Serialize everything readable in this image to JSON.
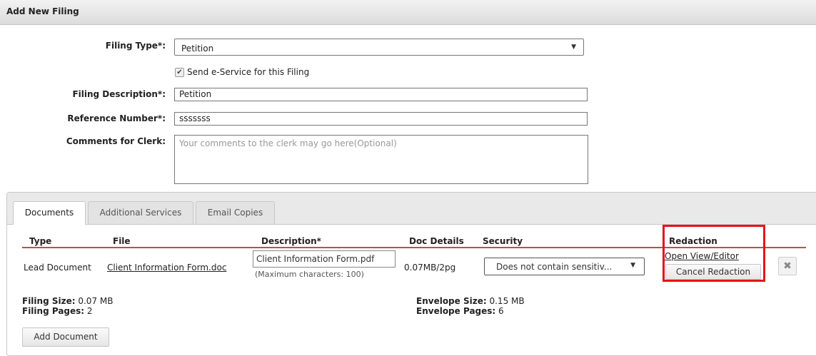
{
  "header": {
    "title": "Add New Filing"
  },
  "form": {
    "filing_type_label": "Filing Type*:",
    "filing_type_value": "Petition",
    "eservice_label": "Send e-Service for this Filing",
    "eservice_checked": true,
    "filing_desc_label": "Filing Description*:",
    "filing_desc_value": "Petition",
    "ref_number_label": "Reference Number*:",
    "ref_number_value": "sssssss",
    "comments_label": "Comments for Clerk:",
    "comments_placeholder": "Your comments to the clerk may go here(Optional)"
  },
  "tabs": [
    {
      "label": "Documents",
      "active": true
    },
    {
      "label": "Additional Services",
      "active": false
    },
    {
      "label": "Email Copies",
      "active": false
    }
  ],
  "table": {
    "headers": [
      "Type",
      "File",
      "Description*",
      "Doc Details",
      "Security",
      "Redaction"
    ],
    "row": {
      "type": "Lead Document",
      "file": "Client Information Form.doc",
      "description": "Client Information Form.pdf",
      "description_note": "(Maximum characters: 100)",
      "doc_details": "0.07MB/2pg",
      "security": "Does not contain sensitiv...",
      "open_view": "Open View/Editor",
      "cancel_redaction": "Cancel Redaction"
    }
  },
  "summary": {
    "filing_size_label": "Filing Size:",
    "filing_size_value": "0.07 MB",
    "filing_pages_label": "Filing Pages:",
    "filing_pages_value": "2",
    "envelope_size_label": "Envelope Size:",
    "envelope_size_value": "0.15 MB",
    "envelope_pages_label": "Envelope Pages:",
    "envelope_pages_value": "6"
  },
  "add_document_label": "Add Document",
  "colors": {
    "highlight": "#e4141b",
    "table_rule": "#c94a4a"
  }
}
